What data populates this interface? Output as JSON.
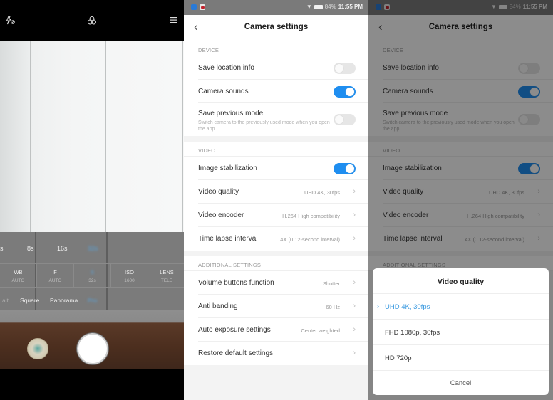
{
  "camera": {
    "top_icons": {
      "flash": "flash-off-icon",
      "filters": "filters-icon",
      "menu": "menu-icon"
    },
    "timer_row": [
      "s",
      "8s",
      "16s",
      "32s"
    ],
    "timer_selected": "32s",
    "params": [
      {
        "name": "WB",
        "value": "AUTO"
      },
      {
        "name": "F",
        "value": "AUTO"
      },
      {
        "name": "S",
        "value": "32s"
      },
      {
        "name": "ISO",
        "value": "1600"
      },
      {
        "name": "LENS",
        "value": "TELE"
      }
    ],
    "modes": [
      "ait",
      "Square",
      "Panorama",
      "Pro"
    ],
    "mode_selected": "Pro"
  },
  "settings": {
    "status_bar": {
      "battery": "84%",
      "time": "11:55 PM"
    },
    "title": "Camera settings",
    "back_glyph": "‹",
    "sections": [
      {
        "header": "DEVICE",
        "items": [
          {
            "label": "Save location info",
            "type": "toggle",
            "on": false
          },
          {
            "label": "Camera sounds",
            "type": "toggle",
            "on": true
          },
          {
            "label": "Save previous mode",
            "type": "toggle",
            "on": false,
            "subtitle": "Switch camera to the previously used mode when you open the app."
          }
        ]
      },
      {
        "header": "VIDEO",
        "items": [
          {
            "label": "Image stabilization",
            "type": "toggle",
            "on": true
          },
          {
            "label": "Video quality",
            "type": "link",
            "value": "UHD 4K, 30fps"
          },
          {
            "label": "Video encoder",
            "type": "link",
            "value": "H.264 High compatibility"
          },
          {
            "label": "Time lapse interval",
            "type": "link",
            "value": "4X (0.12-second interval)"
          }
        ]
      },
      {
        "header": "ADDITIONAL SETTINGS",
        "items": [
          {
            "label": "Volume buttons function",
            "type": "link",
            "value": "Shutter"
          },
          {
            "label": "Anti banding",
            "type": "link",
            "value": "60 Hz"
          },
          {
            "label": "Auto exposure settings",
            "type": "link",
            "value": "Center weighted"
          },
          {
            "label": "Restore default settings",
            "type": "link",
            "value": ""
          }
        ]
      }
    ]
  },
  "dialog": {
    "title": "Video quality",
    "options": [
      {
        "label": "UHD 4K, 30fps",
        "selected": true
      },
      {
        "label": "FHD 1080p, 30fps",
        "selected": false
      },
      {
        "label": "HD 720p",
        "selected": false
      }
    ],
    "cancel_label": "Cancel"
  },
  "colors": {
    "accent": "#1f8ef0",
    "selected_option": "#3b9ae0"
  }
}
